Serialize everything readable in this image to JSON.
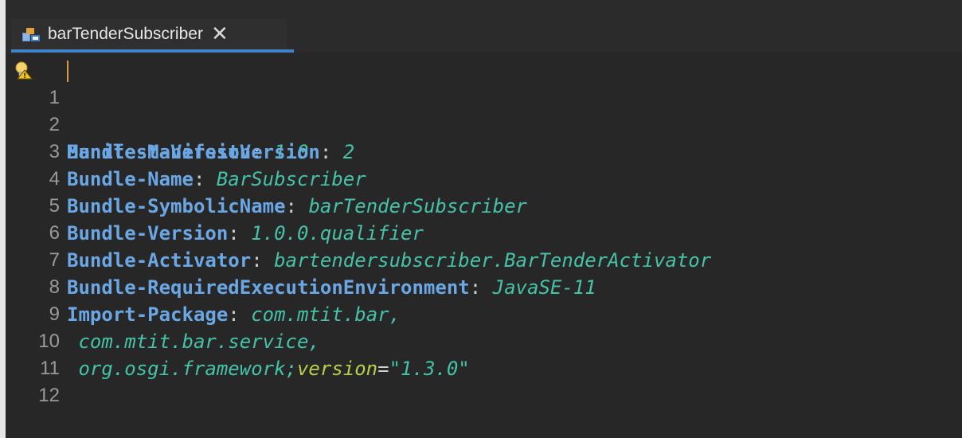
{
  "tab": {
    "title": "barTenderSubscriber",
    "close_glyph": "✕",
    "icon": "plugin-manifest-icon"
  },
  "editor": {
    "lines": [
      {
        "num": "1",
        "key": "Manifest-Version",
        "sep": ": ",
        "value": "1.0"
      },
      {
        "num": "2",
        "key": "Bundle-ManifestVersion",
        "sep": ": ",
        "value": "2"
      },
      {
        "num": "3",
        "key": "Bundle-Name",
        "sep": ": ",
        "value": "BarSubscriber"
      },
      {
        "num": "4",
        "key": "Bundle-SymbolicName",
        "sep": ": ",
        "value": "barTenderSubscriber"
      },
      {
        "num": "5",
        "key": "Bundle-Version",
        "sep": ": ",
        "value": "1.0.0.qualifier"
      },
      {
        "num": "6",
        "key": "Bundle-Activator",
        "sep": ": ",
        "value": "bartendersubscriber.BarTenderActivator"
      },
      {
        "num": "7",
        "key": "Bundle-RequiredExecutionEnvironment",
        "sep": ": ",
        "value": "JavaSE-11"
      },
      {
        "num": "8",
        "key": "Import-Package",
        "sep": ": ",
        "value": "com.mtit.bar,"
      },
      {
        "num": "9",
        "value": " com.mtit.bar.service,"
      },
      {
        "num": "10",
        "value": " org.osgi.framework;",
        "attr": "version",
        "eq": "=",
        "str": "\"1.3.0\""
      },
      {
        "num": "11"
      },
      {
        "num": "12"
      }
    ]
  },
  "colors": {
    "key": "#6aa7e4",
    "value": "#45c2a8",
    "attribute": "#b7d04a",
    "background": "#272727",
    "tab_accent": "#3d83c6"
  }
}
